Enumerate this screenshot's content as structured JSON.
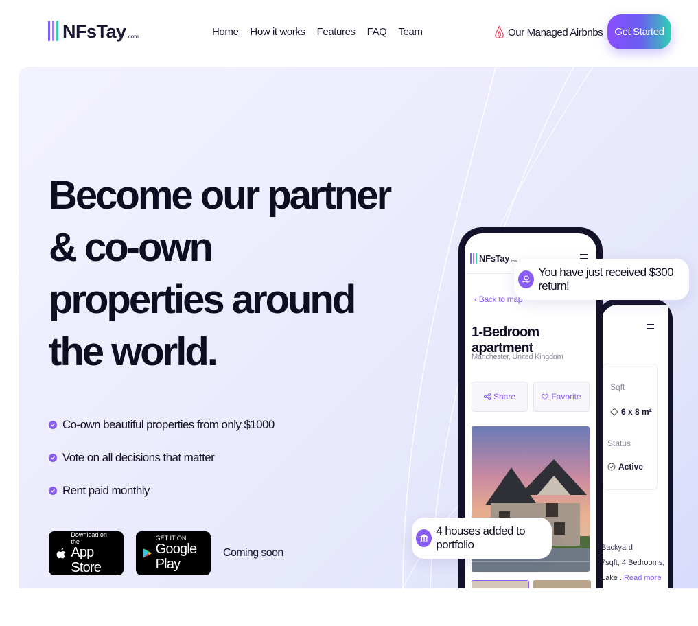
{
  "nav": {
    "logo_text": "NFsTay",
    "logo_suffix": ".com",
    "menu": [
      {
        "label": "Home"
      },
      {
        "label": "How it works"
      },
      {
        "label": "Features"
      },
      {
        "label": "FAQ"
      },
      {
        "label": "Team"
      }
    ],
    "airbnb_link": "Our Managed Airbnbs",
    "airbnb_icon": "airbnb-icon",
    "cta": "Get Started"
  },
  "hero": {
    "headline_lines": [
      "Become our partner",
      "& co-own",
      "properties around",
      "the world."
    ],
    "features": [
      {
        "text": "Co-own beautiful properties  from only $1000"
      },
      {
        "text": "Vote on all decisions that matter"
      },
      {
        "text": "Rent paid monthly"
      }
    ],
    "app_store": {
      "small": "Download on the",
      "big": "App Store"
    },
    "google_play": {
      "small": "GET IT ON",
      "big": "Google Play"
    },
    "coming_soon": "Coming soon"
  },
  "phone": {
    "logo_text": "NFsTay",
    "logo_suffix": ".com",
    "back_link": "Back to map",
    "title": "1-Bedroom apartment",
    "location": "Manchester, United Kingdom",
    "share_label": "Share",
    "favorite_label": "Favorite"
  },
  "phone2": {
    "sqft_label": "Sqft",
    "sqft_value": "6 x 8 m²",
    "status_label": "Status",
    "status_value": "Active",
    "desc_lines": [
      "Backyard",
      "7sqft, 4 Bedrooms,",
      "Lake ."
    ],
    "read_more": "Read more"
  },
  "toasts": {
    "return_text": "You have just received $300 return!",
    "portfolio_text": "4 houses added to portfolio"
  },
  "colors": {
    "accent": "#8a5cf6",
    "gradient_start": "#8a4dff",
    "gradient_end": "#2fcfb3",
    "dark": "#0f0d22"
  }
}
